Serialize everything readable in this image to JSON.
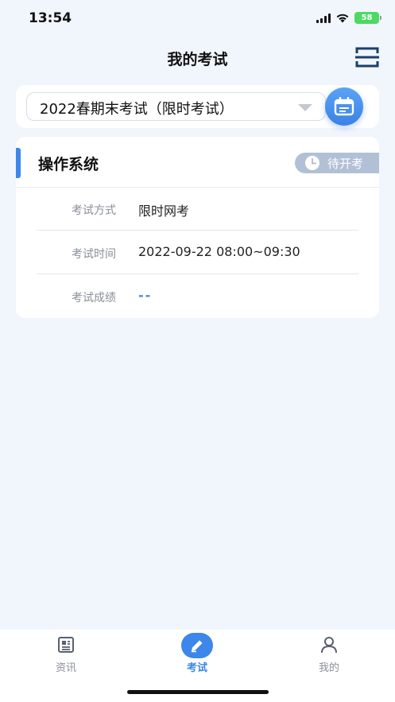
{
  "status_bar": {
    "time": "13:54",
    "battery": "58"
  },
  "header": {
    "title": "我的考试"
  },
  "exam_select": {
    "selected": "2022春期末考试（限时考试）"
  },
  "exam_card": {
    "title": "操作系统",
    "status": "待开考",
    "rows": [
      {
        "label": "考试方式",
        "value": "限时网考"
      },
      {
        "label": "考试时间",
        "value": "2022-09-22 08:00~09:30"
      },
      {
        "label": "考试成绩",
        "value": "--"
      }
    ]
  },
  "bottom_nav": {
    "items": [
      {
        "label": "资讯",
        "icon": "news-icon"
      },
      {
        "label": "考试",
        "icon": "pencil-icon",
        "active": true
      },
      {
        "label": "我的",
        "icon": "person-icon"
      }
    ]
  },
  "colors": {
    "accent": "#3d86ea",
    "background": "#f1f6fd",
    "badge": "#b2c0d6"
  }
}
